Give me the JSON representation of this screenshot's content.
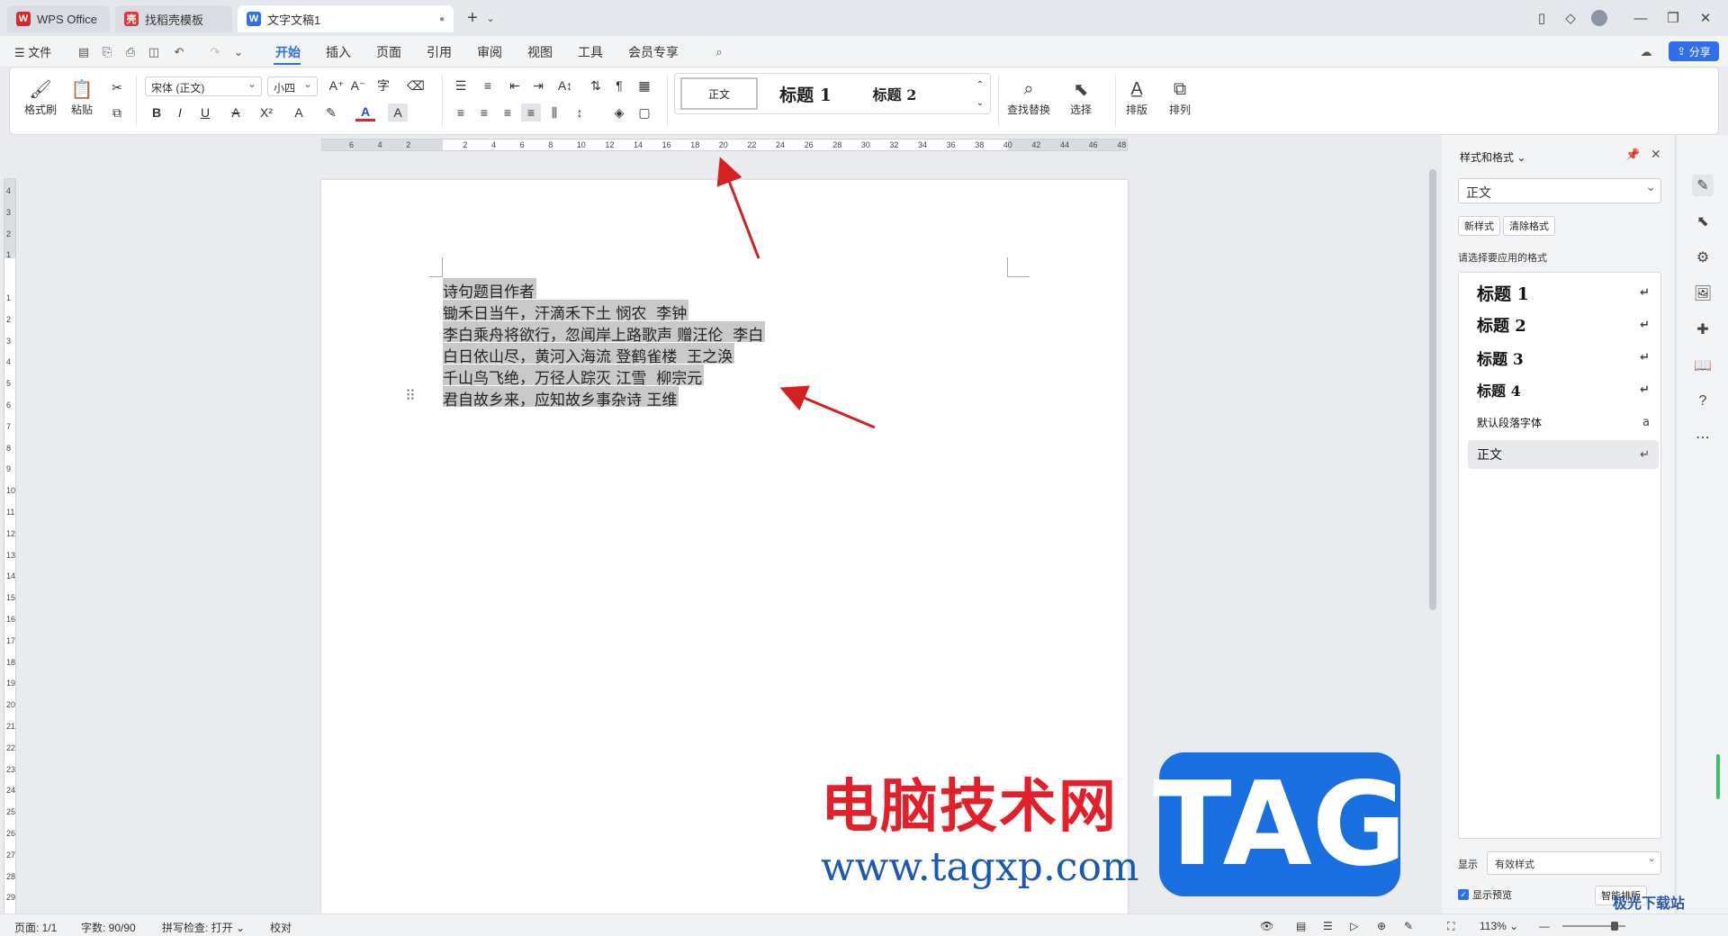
{
  "tabs": [
    {
      "label": "WPS Office",
      "color": "#d8262b"
    },
    {
      "label": "找稻壳模板",
      "color": "#e0353d"
    },
    {
      "label": "文字文稿1",
      "color": "#2f6fe8"
    }
  ],
  "menu": {
    "file": "文件",
    "items": [
      "开始",
      "插入",
      "页面",
      "引用",
      "审阅",
      "视图",
      "工具",
      "会员专享"
    ],
    "active": "开始",
    "share": "分享"
  },
  "ribbon": {
    "format_painter": "格式刷",
    "paste": "粘贴",
    "font_name": "宋体 (正文)",
    "font_size": "小四",
    "style_normal": "正文",
    "style_h1": "标题 1",
    "style_h2": "标题 2",
    "find_replace": "查找替换",
    "select": "选择",
    "layout": "排版",
    "arrange": "排列"
  },
  "ruler": {
    "h_ticks": [
      "6",
      "4",
      "2",
      "",
      "2",
      "4",
      "6",
      "8",
      "10",
      "12",
      "14",
      "16",
      "18",
      "20",
      "22",
      "24",
      "26",
      "28",
      "30",
      "32",
      "34",
      "36",
      "38",
      "40",
      "42",
      "44",
      "46",
      "48"
    ],
    "v_ticks": [
      "4",
      "3",
      "2",
      "1",
      "",
      "1",
      "2",
      "3",
      "4",
      "5",
      "6",
      "7",
      "8",
      "9",
      "10",
      "11",
      "12",
      "13",
      "14",
      "15",
      "16",
      "17",
      "18",
      "19",
      "20",
      "21",
      "22",
      "23",
      "24",
      "25",
      "26",
      "27",
      "28",
      "29"
    ]
  },
  "document": {
    "lines": [
      "诗句题目作者",
      "锄禾日当午，汗滴禾下土 悯农  李钟",
      "李白乘舟将欲行，忽闻岸上路歌声 赠汪伦  李白",
      "白日依山尽，黄河入海流 登鹤雀楼  王之涣",
      "千山鸟飞绝，万径人踪灭 江雪  柳宗元",
      "君自故乡来，应知故乡事杂诗 王维"
    ]
  },
  "side_panel": {
    "title": "样式和格式",
    "current_style": "正文",
    "new_style": "新样式",
    "clear_format": "清除格式",
    "prompt": "请选择要应用的格式",
    "styles": [
      "标题 1",
      "标题 2",
      "标题 3",
      "标题 4",
      "默认段落字体",
      "正文"
    ],
    "show_label": "显示",
    "show_value": "有效样式",
    "preview_label": "显示预览",
    "smart_layout": "智能排版"
  },
  "status": {
    "page": "页面: 1/1",
    "words": "字数: 90/90",
    "spell": "拼写检查: 打开",
    "proof": "校对",
    "zoom": "113%"
  },
  "watermark": {
    "cn": "电脑技术网",
    "url": "www.tagxp.com",
    "tag": "TAG",
    "corner": "极光下载站"
  },
  "colors": {
    "accent": "#2f6fe8",
    "selection": "#c9c9c9",
    "arrow": "#d42020"
  }
}
